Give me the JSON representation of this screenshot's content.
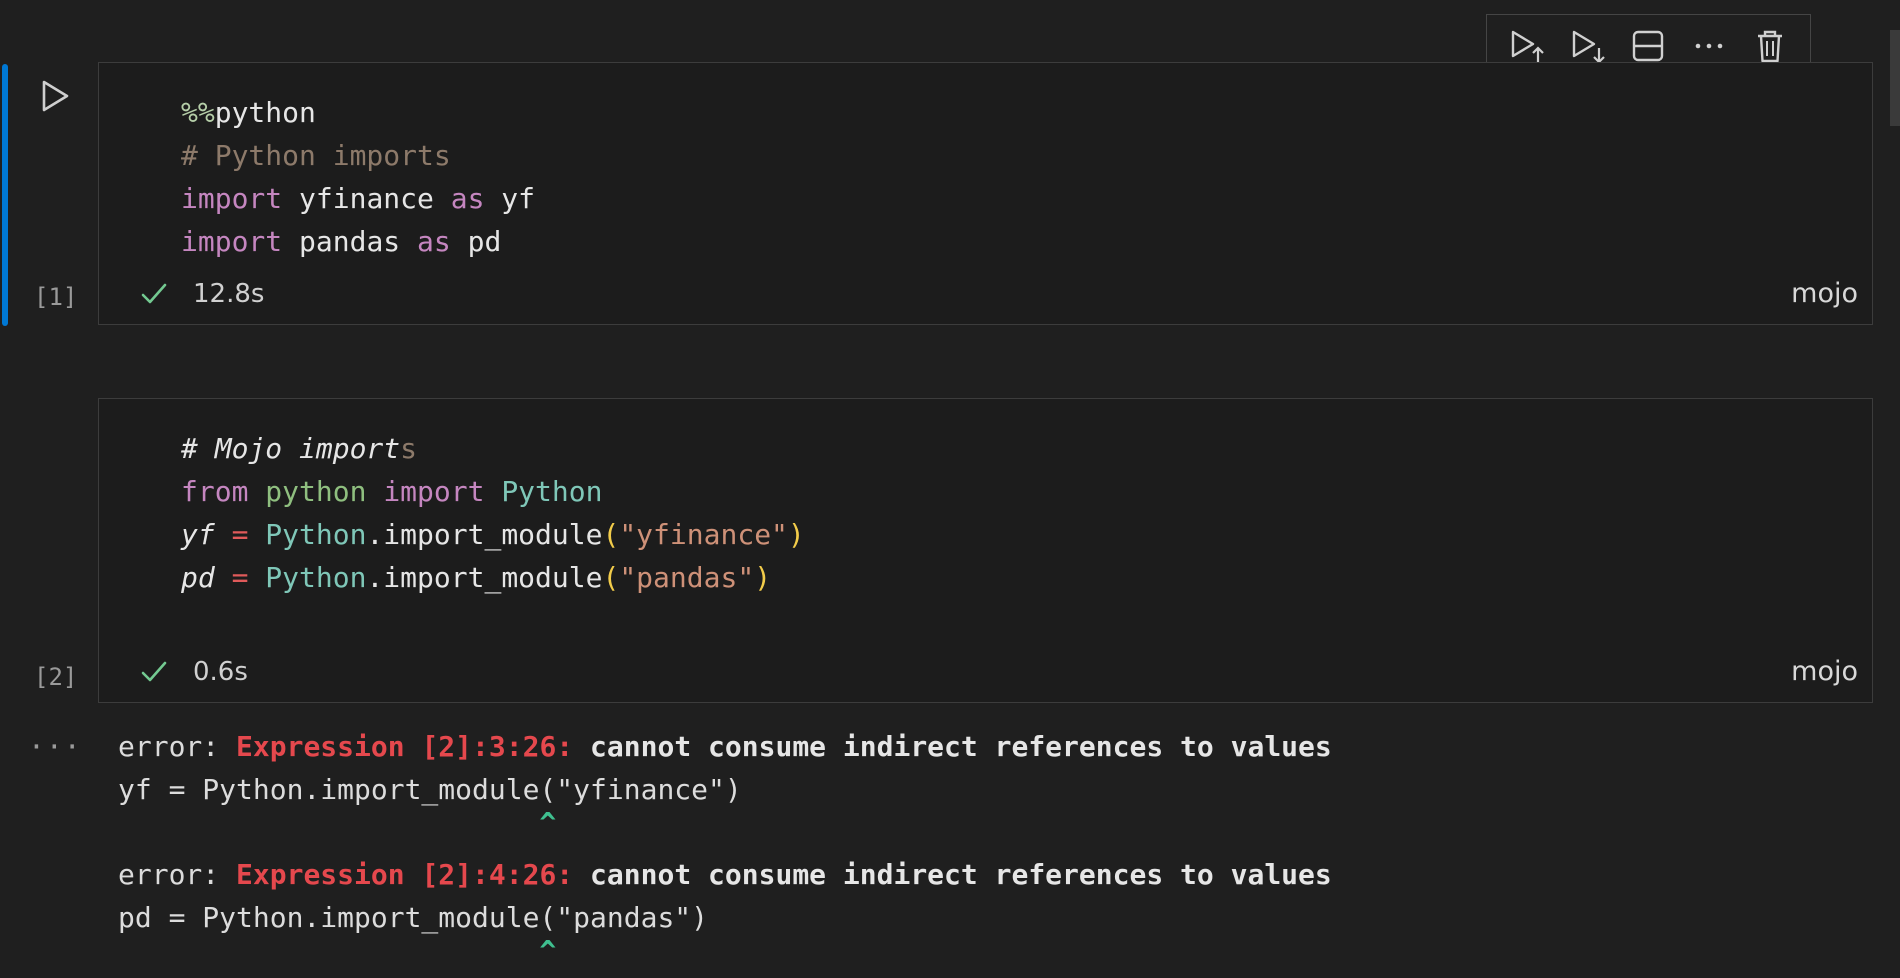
{
  "toolbar": {
    "icons": [
      "run-above-icon",
      "run-below-icon",
      "split-cell-icon",
      "more-actions-icon",
      "delete-icon"
    ]
  },
  "cell1": {
    "lines": [
      [
        {
          "t": "%%",
          "c": "magic"
        },
        {
          "t": "python",
          "c": "plain"
        }
      ],
      [
        {
          "t": "# Python imports",
          "c": "comment"
        }
      ],
      [
        {
          "t": "import",
          "c": "kw"
        },
        {
          "t": " yfinance ",
          "c": "plain"
        },
        {
          "t": "as",
          "c": "kw"
        },
        {
          "t": " yf",
          "c": "plain"
        }
      ],
      [
        {
          "t": "import",
          "c": "kw"
        },
        {
          "t": " pandas ",
          "c": "plain"
        },
        {
          "t": "as",
          "c": "kw"
        },
        {
          "t": " pd",
          "c": "plain"
        }
      ]
    ],
    "exec_count": "[1]",
    "duration": "12.8s",
    "language": "mojo"
  },
  "cell2": {
    "lines": [
      [
        {
          "t": "# Mojo import",
          "c": "comment-ital"
        },
        {
          "t": "s",
          "c": "comment-tail"
        }
      ],
      [
        {
          "t": "from",
          "c": "kw"
        },
        {
          "t": " ",
          "c": "plain"
        },
        {
          "t": "python",
          "c": "mod"
        },
        {
          "t": " ",
          "c": "plain"
        },
        {
          "t": "import",
          "c": "kw"
        },
        {
          "t": " ",
          "c": "plain"
        },
        {
          "t": "Python",
          "c": "cls"
        }
      ],
      [
        {
          "t": "yf",
          "c": "italic"
        },
        {
          "t": " ",
          "c": "plain"
        },
        {
          "t": "=",
          "c": "op"
        },
        {
          "t": " ",
          "c": "plain"
        },
        {
          "t": "Python",
          "c": "cls"
        },
        {
          "t": ".import_module",
          "c": "plain"
        },
        {
          "t": "(",
          "c": "paren"
        },
        {
          "t": "\"yfinance\"",
          "c": "str"
        },
        {
          "t": ")",
          "c": "paren"
        }
      ],
      [
        {
          "t": "pd",
          "c": "italic"
        },
        {
          "t": " ",
          "c": "plain"
        },
        {
          "t": "=",
          "c": "op"
        },
        {
          "t": " ",
          "c": "plain"
        },
        {
          "t": "Python",
          "c": "cls"
        },
        {
          "t": ".import_module",
          "c": "plain"
        },
        {
          "t": "(",
          "c": "paren"
        },
        {
          "t": "\"pandas\"",
          "c": "str"
        },
        {
          "t": ")",
          "c": "paren"
        }
      ]
    ],
    "exec_count": "[2]",
    "duration": "0.6s",
    "language": "mojo"
  },
  "output": {
    "more_label": "···",
    "errors": [
      {
        "prefix": "error: ",
        "location": "Expression [2]:3:26:",
        "message": " cannot consume indirect references to values",
        "source": "yf = Python.import_module(\"yfinance\")",
        "caret": "                         ^"
      },
      {
        "prefix": "error: ",
        "location": "Expression [2]:4:26:",
        "message": " cannot consume indirect references to values",
        "source": "pd = Python.import_module(\"pandas\")",
        "caret": "                         ^"
      }
    ]
  },
  "colors": {
    "background": "#1f1f1f",
    "focus_bar": "#0078d4",
    "error_location": "#e5484d",
    "caret": "#3fbf8f",
    "check": "#73c991"
  }
}
